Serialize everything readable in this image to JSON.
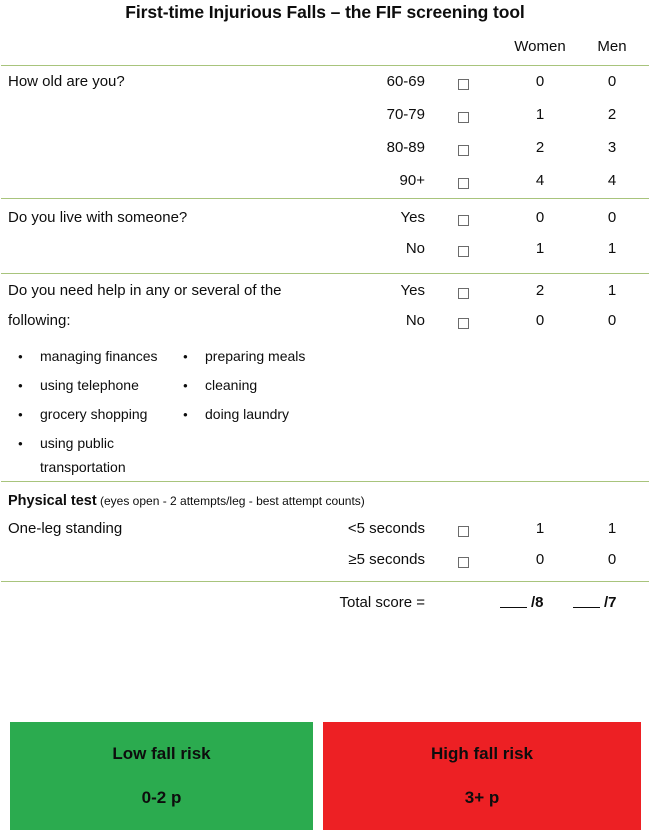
{
  "title": "First-time Injurious Falls – the FIF screening tool",
  "columns": {
    "women": "Women",
    "men": "Men"
  },
  "checkbox_icon": "checkbox-empty",
  "sections": [
    {
      "question": "How old are you?",
      "rows": [
        {
          "option": "60-69",
          "women": "0",
          "men": "0"
        },
        {
          "option": "70-79",
          "women": "1",
          "men": "2"
        },
        {
          "option": "80-89",
          "women": "2",
          "men": "3"
        },
        {
          "option": "90+",
          "women": "4",
          "men": "4"
        }
      ]
    },
    {
      "question": "Do you live with someone?",
      "rows": [
        {
          "option": "Yes",
          "women": "0",
          "men": "0"
        },
        {
          "option": "No",
          "women": "1",
          "men": "1"
        }
      ]
    },
    {
      "question_line1": "Do you need help in any or several of the",
      "question_line2": "following:",
      "rows": [
        {
          "option": "Yes",
          "women": "2",
          "men": "1"
        },
        {
          "option": "No",
          "women": "0",
          "men": "0"
        }
      ],
      "bullets_left": [
        "managing finances",
        "using telephone",
        " grocery shopping",
        " using public"
      ],
      "bullets_left_continuation": "transportation",
      "bullets_right": [
        "preparing meals",
        "cleaning",
        "doing laundry"
      ]
    }
  ],
  "physical_test": {
    "heading": "Physical test",
    "subtitle": " (eyes open - 2 attempts/leg - best attempt counts)",
    "question": "One-leg standing",
    "rows": [
      {
        "option": "<5 seconds",
        "women": "1",
        "men": "1"
      },
      {
        "option": "≥5 seconds",
        "women": "0",
        "men": "0"
      }
    ]
  },
  "total": {
    "label": "Total score =",
    "women_blank": "",
    "women_denominator": "/8",
    "men_blank": "",
    "men_denominator": "/7"
  },
  "risk": {
    "low": {
      "title": "Low fall risk",
      "points": "0-2 p",
      "color": "#2bab4f"
    },
    "high": {
      "title": "High fall risk",
      "points": "3+ p",
      "color": "#ed2024"
    }
  },
  "colors": {
    "rule": "#a8c47c",
    "text": "#0d0d0d"
  }
}
